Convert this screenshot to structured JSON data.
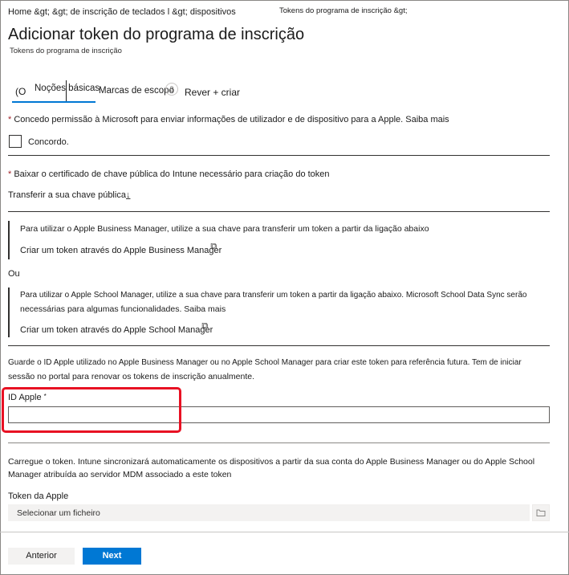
{
  "breadcrumb": {
    "part1": "Home &gt;  &gt; de inscrição de teclados l &gt; dispositivos",
    "part2": "Tokens do programa de inscrição &gt;"
  },
  "page": {
    "title": "Adicionar token do programa de inscrição",
    "subtitle": "Tokens do programa de inscrição"
  },
  "tabs": {
    "prefix": "(O",
    "basics": "Noções básicas",
    "scope_tags": "Marcas de escopo",
    "step_number": "3",
    "review": "Rever + criar"
  },
  "consent": {
    "text": "Concedo permissão à Microsoft para enviar informações de utilizador e de dispositivo para a Apple. Saiba mais",
    "checkbox_label": "Concordo."
  },
  "certificate": {
    "text": "Baixar o certificado de chave pública do Intune necessário para criação do token",
    "download_link": "Transferir a sua chave pública",
    "download_icon": "↓"
  },
  "abm": {
    "text": "Para utilizar o Apple Business Manager, utilize a sua chave para transferir um token a partir da ligação abaixo",
    "link": "Criar um token através do Apple Business Manager",
    "link_icon": "⧉"
  },
  "or_text": "Ou",
  "asm": {
    "text_line1": "Para utilizar o Apple School Manager, utilize a sua chave para transferir um token a partir da ligação abaixo. Microsoft School Data Sync serão",
    "text_line2": "necessárias para algumas funcionalidades. Saiba mais",
    "link": "Criar um token através do Apple School Manager",
    "link_icon": "⧉"
  },
  "apple_id": {
    "note_line1": "Guarde o ID Apple utilizado no Apple Business Manager ou no Apple School Manager para criar este token para referência futura. Tem de iniciar",
    "note_line2": "sessão no portal para renovar os tokens de inscrição anualmente.",
    "label": "ID Apple",
    "required_mark": "*",
    "value": ""
  },
  "upload": {
    "text_line1": "Carregue o token. Intune sincronizará automaticamente os dispositivos a partir da sua conta do Apple Business Manager ou do Apple School",
    "text_line2": "Manager atribuída ao servidor MDM associado a este token",
    "label": "Token da Apple",
    "placeholder": "Selecionar um ficheiro"
  },
  "footer": {
    "prev_label": "Anterior",
    "next_label": "Next"
  },
  "colors": {
    "accent": "#0078d4",
    "highlight": "#e81123",
    "required": "#a4262c"
  }
}
